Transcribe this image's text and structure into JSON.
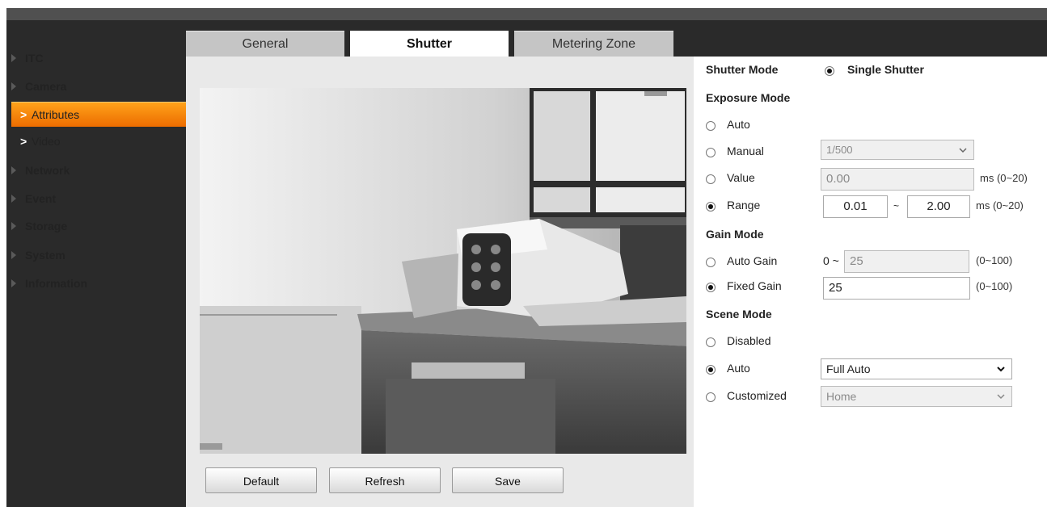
{
  "sidebar": {
    "items": [
      {
        "label": "ITC"
      },
      {
        "label": "Camera"
      },
      {
        "label": "Attributes"
      },
      {
        "label": "Video"
      },
      {
        "label": "Network"
      },
      {
        "label": "Event"
      },
      {
        "label": "Storage"
      },
      {
        "label": "System"
      },
      {
        "label": "Information"
      }
    ],
    "sub_chevron": ">"
  },
  "tabs": [
    {
      "label": "General"
    },
    {
      "label": "Shutter"
    },
    {
      "label": "Metering Zone"
    }
  ],
  "buttons": {
    "default": "Default",
    "refresh": "Refresh",
    "save": "Save"
  },
  "form": {
    "shutter_mode": {
      "label": "Shutter Mode",
      "option": "Single Shutter"
    },
    "exposure_mode": {
      "title": "Exposure Mode",
      "auto": "Auto",
      "manual": "Manual",
      "manual_value": "1/500",
      "value": "Value",
      "value_field": "0.00",
      "value_unit": "ms (0~20)",
      "range": "Range",
      "range_min": "0.01",
      "range_sep": "~",
      "range_max": "2.00",
      "range_unit": "ms (0~20)"
    },
    "gain_mode": {
      "title": "Gain Mode",
      "auto_gain": "Auto Gain",
      "auto_gain_prefix": "0 ~",
      "auto_gain_value": "25",
      "auto_gain_unit": "(0~100)",
      "fixed_gain": "Fixed Gain",
      "fixed_gain_value": "25",
      "fixed_gain_unit": "(0~100)"
    },
    "scene_mode": {
      "title": "Scene Mode",
      "disabled": "Disabled",
      "auto": "Auto",
      "auto_value": "Full Auto",
      "customized": "Customized",
      "customized_value": "Home"
    }
  },
  "colors": {
    "sidebar_bg": "#2a2a2a",
    "active_item": "#f08a00",
    "tab_inactive": "#c5c5c5"
  }
}
